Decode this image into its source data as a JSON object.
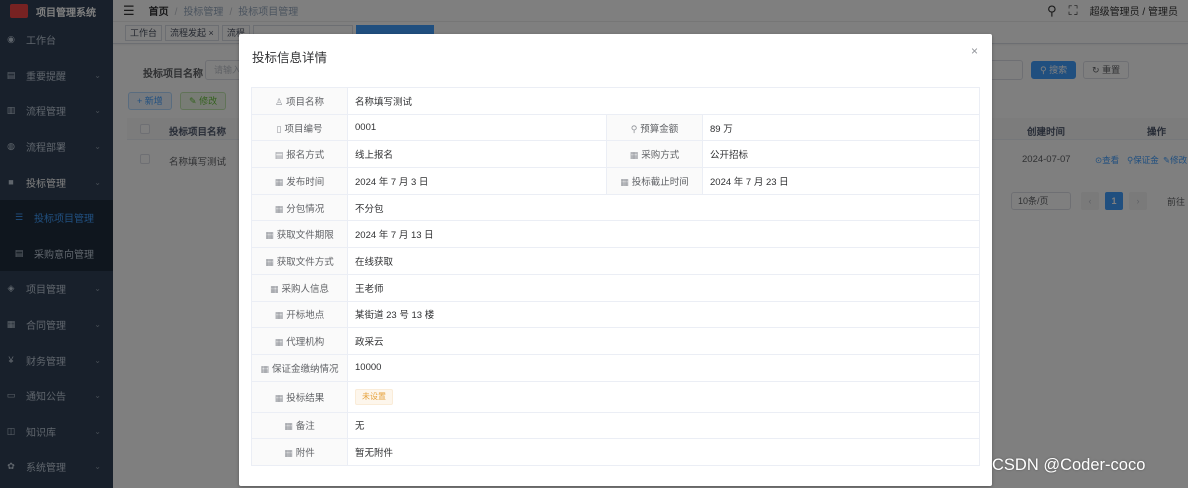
{
  "sidebar": {
    "title": "项目管理系统",
    "items": [
      {
        "label": "工作台",
        "icon": "dashboard-icon",
        "glyph": "◉"
      },
      {
        "label": "重要提醒",
        "icon": "reminder-icon",
        "glyph": "▤"
      },
      {
        "label": "流程管理",
        "icon": "process-icon",
        "glyph": "▥"
      },
      {
        "label": "流程部署",
        "icon": "deploy-icon",
        "glyph": "◍"
      },
      {
        "label": "投标管理",
        "icon": "bid-icon",
        "glyph": "■"
      }
    ],
    "sub_items": [
      {
        "label": "投标项目管理",
        "icon": "list-icon",
        "glyph": "☰"
      },
      {
        "label": "采购意向管理",
        "icon": "doc-icon",
        "glyph": "▤"
      }
    ],
    "items_after": [
      {
        "label": "项目管理",
        "icon": "project-icon",
        "glyph": "◈"
      },
      {
        "label": "合同管理",
        "icon": "contract-icon",
        "glyph": "▦"
      },
      {
        "label": "财务管理",
        "icon": "finance-icon",
        "glyph": "¥"
      },
      {
        "label": "通知公告",
        "icon": "notice-icon",
        "glyph": "▭"
      },
      {
        "label": "知识库",
        "icon": "book-icon",
        "glyph": "◫"
      },
      {
        "label": "系统管理",
        "icon": "settings-icon",
        "glyph": "✿"
      }
    ]
  },
  "navbar": {
    "crumb_home": "首页",
    "crumb_1": "投标管理",
    "crumb_2": "投标项目管理",
    "user": "超级管理员 / 管理员"
  },
  "tags": {
    "t1": "工作台",
    "t2": "流程发起",
    "t2x": "×",
    "t3": "流程"
  },
  "search": {
    "label": "投标项目名称",
    "placeholder": "请输入",
    "search_btn": "搜索",
    "reset_btn": "重置"
  },
  "toolbar": {
    "add": "新增",
    "edit": "修改"
  },
  "table": {
    "col_name": "投标项目名称",
    "col_created": "创建时间",
    "col_ops": "操作",
    "row": {
      "name": "名称填写测试",
      "created": "2024-07-07",
      "view": "查看",
      "deposit": "保证金",
      "edit": "修改"
    }
  },
  "pagination": {
    "page_size": "10条/页",
    "page": "1",
    "goto": "前往"
  },
  "dialog": {
    "title": "投标信息详情",
    "close": "×",
    "fields": {
      "project_name": {
        "label": "项目名称",
        "value": "名称填写测试"
      },
      "project_no": {
        "label": "项目编号",
        "value": "0001"
      },
      "budget": {
        "label": "预算金额",
        "value": "89 万"
      },
      "signup_method": {
        "label": "报名方式",
        "value": "线上报名"
      },
      "purchase_method": {
        "label": "采购方式",
        "value": "公开招标"
      },
      "publish_time": {
        "label": "发布时间",
        "value": "2024 年 7 月 3 日"
      },
      "deadline": {
        "label": "投标截止时间",
        "value": "2024 年 7 月 23 日"
      },
      "subpackage": {
        "label": "分包情况",
        "value": "不分包"
      },
      "doc_deadline": {
        "label": "获取文件期限",
        "value": "2024 年 7 月 13 日"
      },
      "doc_method": {
        "label": "获取文件方式",
        "value": "在线获取"
      },
      "buyer_info": {
        "label": "采购人信息",
        "value": "王老师"
      },
      "bid_location": {
        "label": "开标地点",
        "value": "某街道 23 号 13 楼"
      },
      "agency": {
        "label": "代理机构",
        "value": "政采云"
      },
      "deposit_status": {
        "label": "保证金缴纳情况",
        "value": "10000"
      },
      "bid_result": {
        "label": "投标结果",
        "value": "未设置"
      },
      "remark": {
        "label": "备注",
        "value": "无"
      },
      "attachment": {
        "label": "附件",
        "value": "暂无附件"
      }
    }
  },
  "watermark": "CSDN @Coder-coco"
}
